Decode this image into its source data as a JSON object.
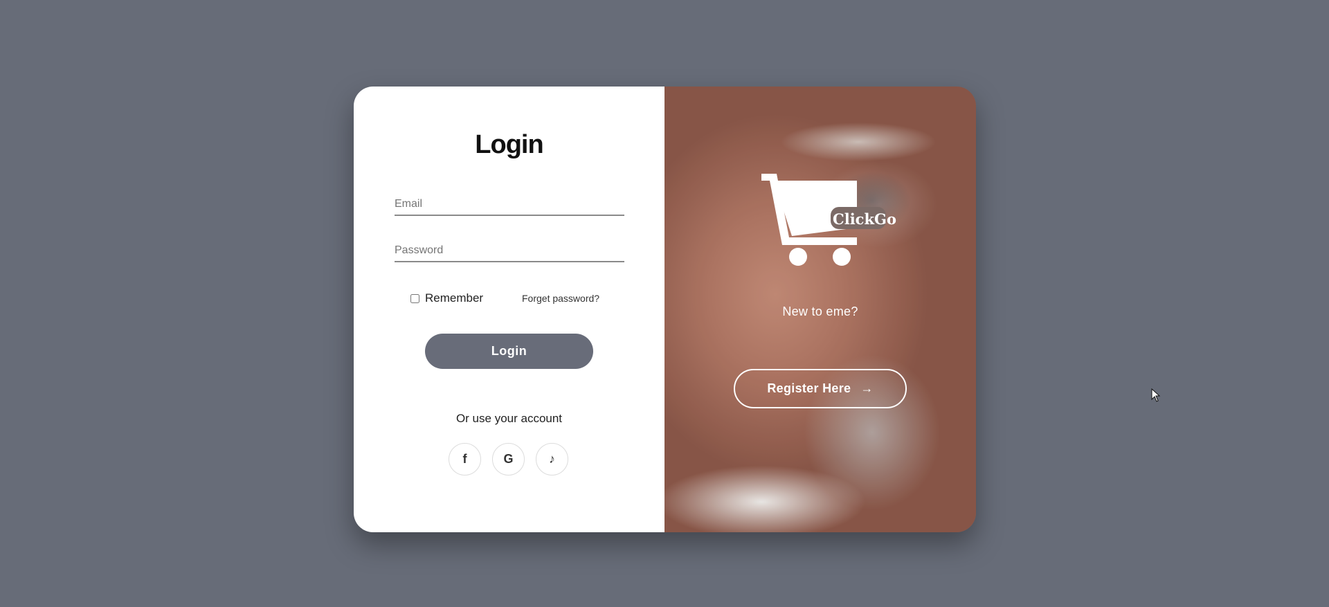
{
  "login": {
    "title": "Login",
    "email_placeholder": "Email",
    "password_placeholder": "Password",
    "remember_label": "Remember",
    "forget_label": "Forget password?",
    "login_button": "Login",
    "alt_text": "Or use your account",
    "socials": [
      {
        "icon": "facebook-icon",
        "glyph": "f"
      },
      {
        "icon": "google-icon",
        "glyph": "G"
      },
      {
        "icon": "tiktok-icon",
        "glyph": "♪"
      }
    ]
  },
  "promo": {
    "brand": "ClickGo",
    "tagline": "New to eme?",
    "register_button": "Register Here",
    "register_arrow": "→"
  },
  "colors": {
    "background": "#676c78",
    "button": "#686c79"
  }
}
